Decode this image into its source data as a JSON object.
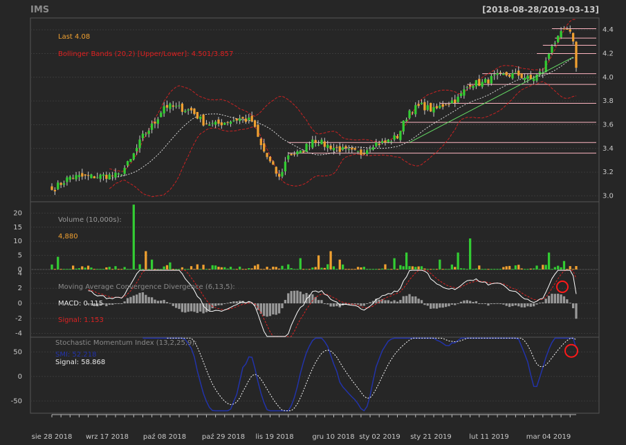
{
  "header": {
    "symbol": "IMS",
    "range": "[2018-08-28/2019-03-13]"
  },
  "colors": {
    "up": "#33cc33",
    "down": "#f0a030",
    "bollinger": "#cc2222",
    "macd_signal": "#dd2222",
    "smi": "#2233aa",
    "smi_signal": "#ffffff",
    "volume_flat": "#999999",
    "support_lines": "#ffb6c1",
    "trendline": "#66dd66",
    "annotation_circle": "#ff1a1a"
  },
  "legend": {
    "last": "Last 4.08",
    "bollinger": "Bollinger Bands (20,2) [Upper/Lower]: 4.501/3.857",
    "volume_title": "Volume (10,000s):",
    "volume_value": "4,880",
    "macd_title": "Moving Average Convergence Divergence (6,13,5):",
    "macd_value": "MACD: 0.115",
    "signal_value": "Signal: 1.153",
    "smi_title": "Stochastic Momentum Index (13,2,25,9):",
    "smi_value": "SMI: 52.218",
    "smi_signal_value": "Signal: 58.868"
  },
  "chart_data": {
    "type": "candlestick",
    "x_labels": [
      "sie 28 2018",
      "wrz 17 2018",
      "paź 08 2018",
      "paź 29 2018",
      "lis 19 2018",
      "gru 10 2018",
      "sty 02 2019",
      "sty 21 2019",
      "lut 11 2019",
      "mar 04 2019"
    ],
    "price_axis": {
      "ylim": [
        2.95,
        4.5
      ],
      "ticks": [
        "3.0",
        "3.2",
        "3.4",
        "3.6",
        "3.8",
        "4.0",
        "4.2",
        "4.4"
      ]
    },
    "volume_axis": {
      "ylim": [
        0,
        24
      ],
      "ticks": [
        "0",
        "5",
        "10",
        "15",
        "20"
      ]
    },
    "macd_axis": {
      "ylim": [
        -4.5,
        4.5
      ],
      "ticks": [
        "-4",
        "-2",
        "0",
        "2",
        "4"
      ]
    },
    "smi_axis": {
      "ylim": [
        -75,
        80
      ],
      "ticks": [
        "-50",
        "0",
        "50"
      ]
    },
    "close_anchors": [
      [
        0,
        3.05
      ],
      [
        6,
        3.16
      ],
      [
        12,
        3.16
      ],
      [
        18,
        3.17
      ],
      [
        22,
        3.17
      ],
      [
        26,
        3.3
      ],
      [
        30,
        3.5
      ],
      [
        34,
        3.62
      ],
      [
        37,
        3.76
      ],
      [
        42,
        3.74
      ],
      [
        46,
        3.72
      ],
      [
        50,
        3.62
      ],
      [
        54,
        3.6
      ],
      [
        58,
        3.63
      ],
      [
        62,
        3.65
      ],
      [
        66,
        3.63
      ],
      [
        69,
        3.42
      ],
      [
        72,
        3.28
      ],
      [
        75,
        3.15
      ],
      [
        78,
        3.35
      ],
      [
        82,
        3.36
      ],
      [
        86,
        3.48
      ],
      [
        90,
        3.43
      ],
      [
        94,
        3.4
      ],
      [
        98,
        3.37
      ],
      [
        102,
        3.36
      ],
      [
        106,
        3.44
      ],
      [
        110,
        3.45
      ],
      [
        114,
        3.5
      ],
      [
        118,
        3.72
      ],
      [
        122,
        3.76
      ],
      [
        126,
        3.72
      ],
      [
        130,
        3.78
      ],
      [
        134,
        3.82
      ],
      [
        138,
        3.95
      ],
      [
        142,
        3.95
      ],
      [
        146,
        4.0
      ],
      [
        150,
        4.02
      ],
      [
        154,
        4.02
      ],
      [
        158,
        3.98
      ],
      [
        162,
        4.05
      ],
      [
        165,
        4.28
      ],
      [
        167,
        4.32
      ],
      [
        169,
        4.4
      ],
      [
        171,
        4.36
      ],
      [
        172,
        4.32
      ],
      [
        173,
        4.08
      ]
    ],
    "support_levels": [
      4.41,
      4.33,
      4.27,
      4.2,
      4.03,
      3.94,
      3.78,
      3.62,
      3.45,
      3.36
    ],
    "volume_spikes": [
      [
        2,
        4.5
      ],
      [
        27,
        23
      ],
      [
        31,
        6.5
      ],
      [
        33,
        3.5
      ],
      [
        39,
        2.5
      ],
      [
        82,
        4
      ],
      [
        88,
        5
      ],
      [
        92,
        6.5
      ],
      [
        95,
        3.5
      ],
      [
        113,
        4
      ],
      [
        117,
        6
      ],
      [
        128,
        3.5
      ],
      [
        134,
        6
      ],
      [
        138,
        11
      ],
      [
        164,
        6
      ],
      [
        169,
        3
      ]
    ],
    "volume_last": 4.88,
    "macd_last": 0.115,
    "macd_signal_last": 1.153,
    "smi_last": 52.218,
    "smi_signal_last": 58.868
  }
}
